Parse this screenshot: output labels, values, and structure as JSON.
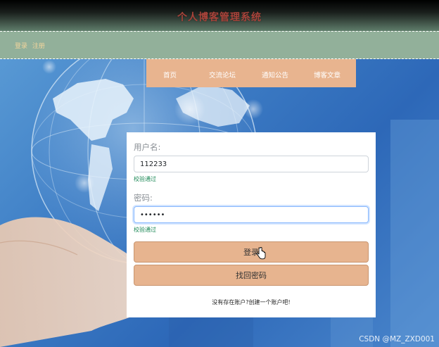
{
  "header": {
    "title": "个人博客管理系统",
    "login_link": "登录",
    "register_link": "注册"
  },
  "nav": {
    "items": [
      {
        "label": "首页"
      },
      {
        "label": "交流论坛"
      },
      {
        "label": "通知公告"
      },
      {
        "label": "博客文章"
      }
    ]
  },
  "login_form": {
    "username_label": "用户名:",
    "username_value": "112233",
    "username_validation": "校验通过",
    "password_label": "密码:",
    "password_value": "••••••",
    "password_validation": "校验通过",
    "login_button": "登录",
    "forgot_button": "找回密码",
    "signup_hint": "没有存在账户?创建一个账户吧!"
  },
  "watermark": "CSDN @MZ_ZXD001",
  "colors": {
    "header_strip": "#92b09a",
    "nav_bg": "#e8b48f",
    "title_color": "#a8433a",
    "auth_link_color": "#f2d59c",
    "button_bg": "#e7b48f",
    "validation_color": "#198754"
  }
}
